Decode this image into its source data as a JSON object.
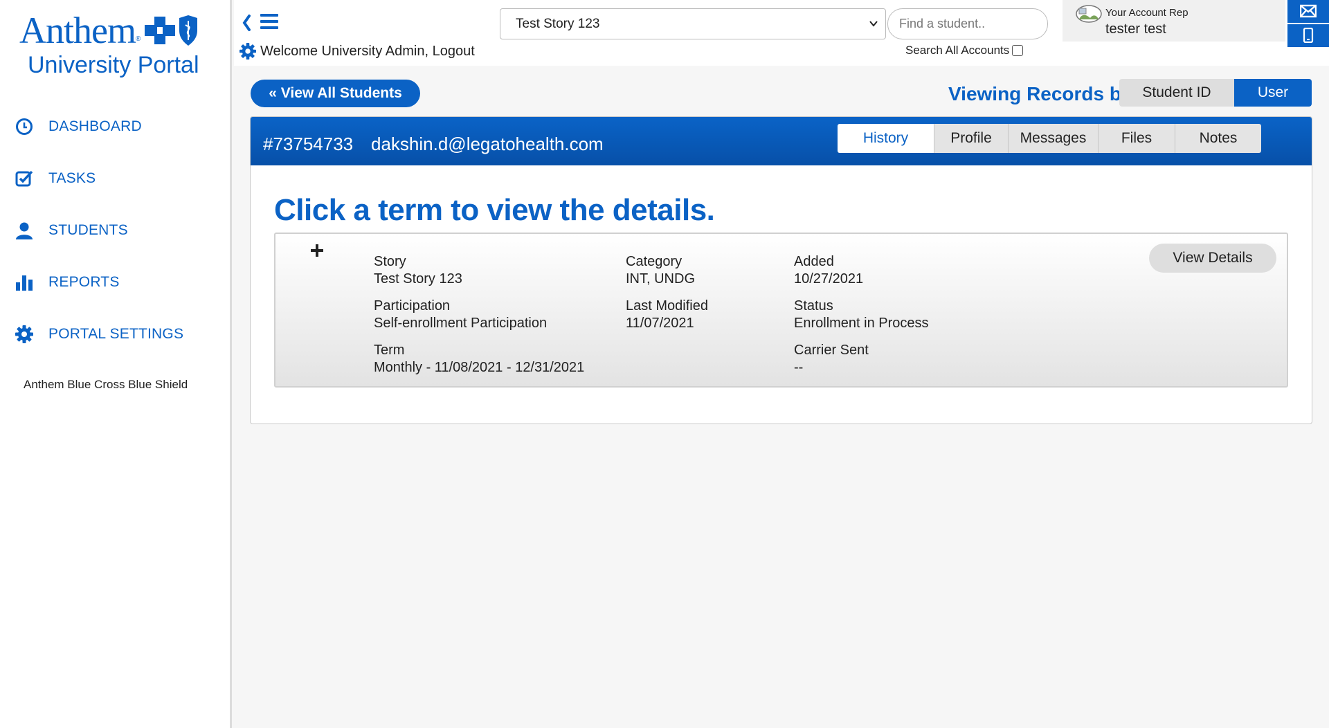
{
  "brand": {
    "logo_text": "Anthem",
    "subtitle": "University Portal",
    "colors": {
      "primary": "#0b62c5",
      "background": "#f6f6f6"
    }
  },
  "sidebar": {
    "items": [
      {
        "label": "DASHBOARD",
        "icon": "clock-icon"
      },
      {
        "label": "TASKS",
        "icon": "checkbox-icon"
      },
      {
        "label": "STUDENTS",
        "icon": "user-icon"
      },
      {
        "label": "REPORTS",
        "icon": "bar-chart-icon"
      },
      {
        "label": "PORTAL SETTINGS",
        "icon": "gear-icon"
      }
    ],
    "org_name": "Anthem Blue Cross Blue Shield"
  },
  "header": {
    "welcome": "Welcome University Admin, Logout",
    "story_select": {
      "selected": "Test Story 123"
    },
    "find_student": {
      "placeholder": "Find a student..",
      "value": ""
    },
    "search_all_label": "Search All Accounts",
    "search_all_checked": false,
    "account_rep": {
      "title": "Your Account Rep",
      "name": "tester test"
    }
  },
  "main": {
    "view_all_label": "« View All Students",
    "viewing_label": "Viewing Records by:",
    "viewing_options": [
      "Student ID",
      "User"
    ],
    "viewing_selected": "User",
    "student": {
      "id": "#73754733",
      "email": "dakshin.d@legatohealth.com"
    },
    "tabs": [
      "History",
      "Profile",
      "Messages",
      "Files",
      "Notes"
    ],
    "active_tab": "History",
    "heading": "Click a term to view the details.",
    "term": {
      "story_label": "Story",
      "story_value": "Test Story 123",
      "category_label": "Category",
      "category_value": "INT, UNDG",
      "added_label": "Added",
      "added_value": "10/27/2021",
      "participation_label": "Participation",
      "participation_value": "Self-enrollment Participation",
      "last_modified_label": "Last Modified",
      "last_modified_value": "11/07/2021",
      "status_label": "Status",
      "status_value": "Enrollment in Process",
      "term_label": "Term",
      "term_value": "Monthly - 11/08/2021 - 12/31/2021",
      "carrier_sent_label": "Carrier Sent",
      "carrier_sent_value": "--",
      "view_details_label": "View Details"
    }
  }
}
